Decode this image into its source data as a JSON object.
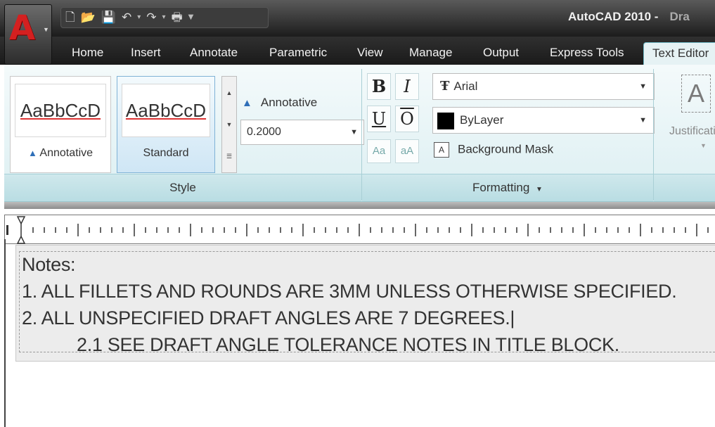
{
  "window": {
    "title": "AutoCAD 2010 -",
    "document_title": "Dra"
  },
  "qat": {
    "icons": [
      "new-icon",
      "open-icon",
      "save-icon",
      "undo-icon",
      "redo-icon",
      "plot-icon",
      "customize-caret-icon"
    ]
  },
  "tabs": [
    "Home",
    "Insert",
    "Annotate",
    "Parametric",
    "View",
    "Manage",
    "Output",
    "Express Tools",
    "Text Editor"
  ],
  "active_tab": "Text Editor",
  "style_panel": {
    "title": "Style",
    "styles": [
      {
        "preview": "AaBbCcD",
        "label": "Annotative"
      },
      {
        "preview": "AaBbCcD",
        "label": "Standard",
        "selected": true
      }
    ],
    "annotative_label": "Annotative",
    "text_height": "0.2000"
  },
  "formatting_panel": {
    "title": "Formatting",
    "bold": "B",
    "italic": "I",
    "underline": "U",
    "overline": "O",
    "uppercase": "Aa",
    "lowercase": "aA",
    "font": "Arial",
    "color": "ByLayer",
    "background_mask": "Background Mask"
  },
  "paragraph_panel": {
    "justification": "Justificati"
  },
  "editor": {
    "lines": [
      "Notes:",
      "1. ALL FILLETS AND ROUNDS ARE 3MM UNLESS OTHERWISE SPECIFIED.",
      "2. ALL UNSPECIFIED DRAFT ANGLES ARE 7 DEGREES.|",
      "2.1 SEE DRAFT ANGLE TOLERANCE NOTES IN TITLE BLOCK."
    ]
  },
  "colors": {
    "ribbon": "#dceff2",
    "accent": "#6fb8c4",
    "titlebar": "#2a2a2a",
    "logo": "#d42020"
  }
}
